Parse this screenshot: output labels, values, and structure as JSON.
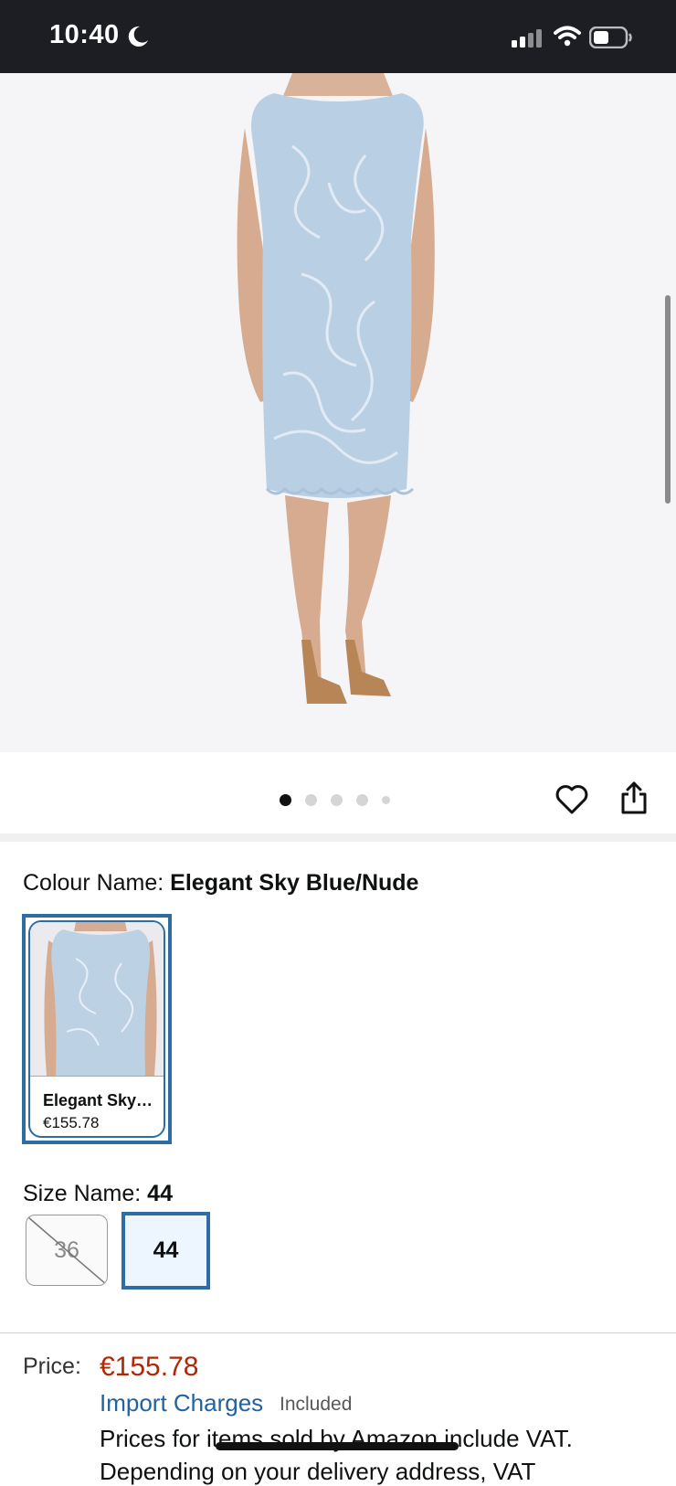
{
  "status_bar": {
    "time": "10:40",
    "icons": [
      "moon-icon",
      "signal-icon",
      "wifi-icon",
      "battery-icon"
    ]
  },
  "product": {
    "image_alt": "Elegant Sky Blue/Nude lace dress",
    "carousel": {
      "total_images": 5,
      "active_index": 0
    }
  },
  "actions": {
    "icons": [
      "heart-icon",
      "share-icon"
    ]
  },
  "colour": {
    "label": "Colour Name: ",
    "value": "Elegant Sky Blue/Nude",
    "swatches": [
      {
        "name": "Elegant Sky…",
        "price": "€155.78",
        "selected": true
      }
    ]
  },
  "size": {
    "label": "Size Name: ",
    "value": "44",
    "options": [
      {
        "label": "36",
        "available": false
      },
      {
        "label": "44",
        "available": true,
        "selected": true
      }
    ]
  },
  "price": {
    "label": "Price:",
    "value": "€155.78",
    "import_link": "Import Charges",
    "import_status": "Included",
    "vat_line": "Prices for items sold by Amazon include VAT.",
    "vat_line_2": "Depending on your delivery address, VAT"
  },
  "colors": {
    "accent_blue": "#2e6da4",
    "price_red": "#b12704",
    "link_blue": "#2162a1"
  }
}
